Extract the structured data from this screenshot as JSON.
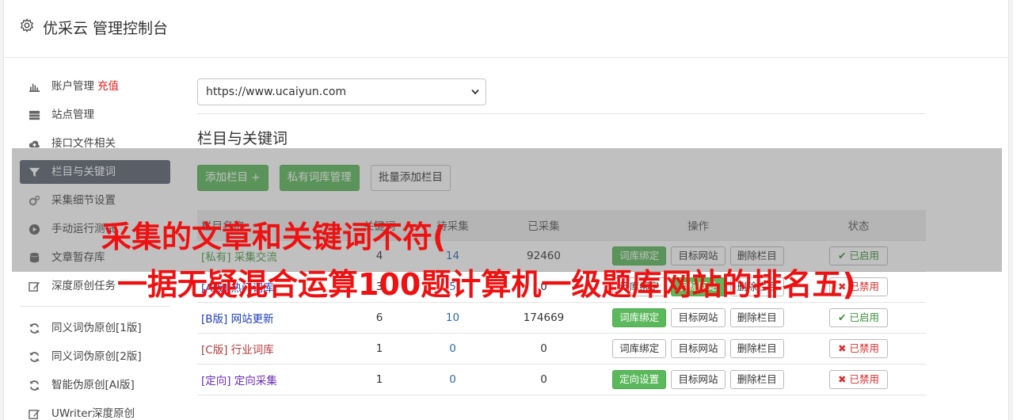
{
  "header": {
    "title": "优采云 管理控制台"
  },
  "sidebar": {
    "items": [
      {
        "label": "账户管理",
        "extra": "充值",
        "icon": "bar-chart-icon",
        "active": false
      },
      {
        "label": "站点管理",
        "icon": "server-icon",
        "active": false
      },
      {
        "label": "接口文件相关",
        "icon": "cloud-upload-icon",
        "active": false
      },
      {
        "label": "栏目与关键词",
        "icon": "filter-icon",
        "active": true
      },
      {
        "label": "采集细节设置",
        "icon": "cogs-icon",
        "active": false
      },
      {
        "label": "手动运行测试",
        "icon": "play-circle-icon",
        "active": false
      },
      {
        "label": "文章暂存库",
        "icon": "database-icon",
        "active": false
      },
      {
        "label": "深度原创任务",
        "icon": "edit-icon",
        "active": false
      }
    ],
    "items2": [
      {
        "label": "同义词伪原创[1版]",
        "icon": "refresh-icon"
      },
      {
        "label": "同义词伪原创[2版]",
        "icon": "refresh-icon"
      },
      {
        "label": "智能伪原创[AI版]",
        "icon": "refresh-icon"
      },
      {
        "label": "UWriter深度原创",
        "icon": "edit-icon"
      }
    ]
  },
  "main": {
    "site_select": "https://www.ucaiyun.com",
    "section_title": "栏目与关键词",
    "buttons": {
      "add_column": "添加栏目 +",
      "private_lib": "私有词库管理",
      "batch_add": "批量添加栏目"
    },
    "table": {
      "headers": [
        "栏目名称",
        "关键词",
        "待采集",
        "已采集",
        "操作",
        "状态"
      ],
      "rows": [
        {
          "tag": "[私有]",
          "name": "采集交流",
          "color": "green",
          "kw": "4",
          "pending": "14",
          "done": "92460",
          "lib": "词库绑定",
          "lib_green": true,
          "target": "目标网站",
          "del": "删除栏目",
          "status": "已启用",
          "on": true
        },
        {
          "tag": "[A版]",
          "name": "热门词库",
          "color": "blue",
          "kw": "3",
          "pending": "5",
          "done": "0",
          "lib": "词库绑定",
          "lib_green": false,
          "target": "目标网站",
          "del": "删除栏目",
          "status": "已禁用",
          "on": false
        },
        {
          "tag": "[B版]",
          "name": "网站更新",
          "color": "blue",
          "kw": "6",
          "pending": "10",
          "done": "174669",
          "lib": "词库绑定",
          "lib_green": true,
          "target": "目标网站",
          "del": "删除栏目",
          "status": "已启用",
          "on": true
        },
        {
          "tag": "[C版]",
          "name": "行业词库",
          "color": "red",
          "kw": "1",
          "pending": "0",
          "done": "0",
          "lib": "词库绑定",
          "lib_green": false,
          "target": "目标网站",
          "del": "删除栏目",
          "status": "已禁用",
          "on": false
        },
        {
          "tag": "[定向]",
          "name": "定向采集",
          "color": "purple",
          "kw": "1",
          "pending": "0",
          "done": "0",
          "lib": "定向设置",
          "lib_green": true,
          "target": "目标网站",
          "del": "删除栏目",
          "status": "已禁用",
          "on": false
        }
      ]
    }
  },
  "overlay": {
    "line1": "采集的文章和关键词不符(",
    "line2": "一据无疑混合运算100题计算机一级题库网站的排名五)"
  }
}
